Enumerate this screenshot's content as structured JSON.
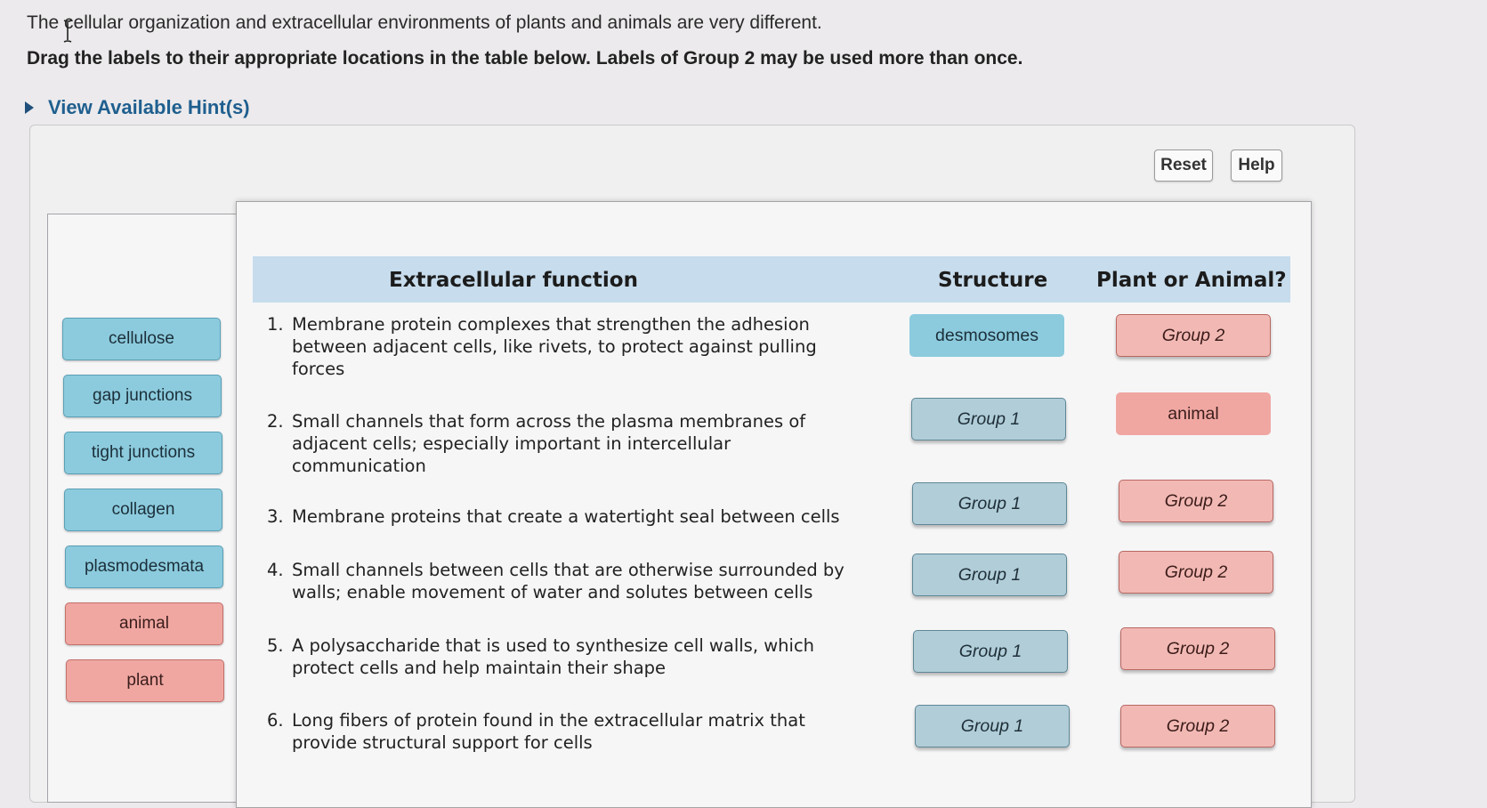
{
  "intro_text": "The cellular organization and extracellular environments of plants and animals are very different.",
  "instruction": "Drag the labels to their appropriate locations in the table below. Labels of Group 2 may be used more than once.",
  "hint_link": "View Available Hint(s)",
  "toolbar": {
    "reset": "Reset",
    "help": "Help"
  },
  "label_bank": [
    {
      "text": "cellulose",
      "group": "Group 1"
    },
    {
      "text": "gap junctions",
      "group": "Group 1"
    },
    {
      "text": "tight junctions",
      "group": "Group 1"
    },
    {
      "text": "collagen",
      "group": "Group 1"
    },
    {
      "text": "plasmodesmata",
      "group": "Group 1"
    },
    {
      "text": "animal",
      "group": "Group 2"
    },
    {
      "text": "plant",
      "group": "Group 2"
    }
  ],
  "table": {
    "headers": {
      "function": "Extracellular function",
      "structure": "Structure",
      "organism": "Plant or Animal?"
    },
    "rows": [
      {
        "num": "1.",
        "text": "Membrane protein complexes that strengthen the adhesion between adjacent cells, like rivets, to protect against pulling forces",
        "structure": "desmosomes",
        "organism": "Group 2"
      },
      {
        "num": "2.",
        "text": "Small channels that form across the plasma membranes of adjacent cells; especially important in intercellular communication",
        "structure": "Group 1",
        "organism": "animal"
      },
      {
        "num": "3.",
        "text": "Membrane proteins that create a watertight seal between cells",
        "structure": "Group 1",
        "organism": "Group 2"
      },
      {
        "num": "4.",
        "text": "Small channels between cells that are otherwise surrounded by walls; enable movement of water and solutes between cells",
        "structure": "Group 1",
        "organism": "Group 2"
      },
      {
        "num": "5.",
        "text": "A polysaccharide that is used to synthesize cell walls, which protect cells and help maintain their shape",
        "structure": "Group 1",
        "organism": "Group 2"
      },
      {
        "num": "6.",
        "text": "Long fibers of protein found in the extracellular matrix that provide structural support for cells",
        "structure": "Group 1",
        "organism": "Group 2"
      }
    ]
  },
  "colors": {
    "group1": "#8ccbdd",
    "group2": "#f0a7a2",
    "header": "#c7dcec",
    "hint": "#1f5f8f"
  },
  "icons": {
    "cursor": "text-cursor-icon",
    "hint": "triangle-right-icon"
  }
}
